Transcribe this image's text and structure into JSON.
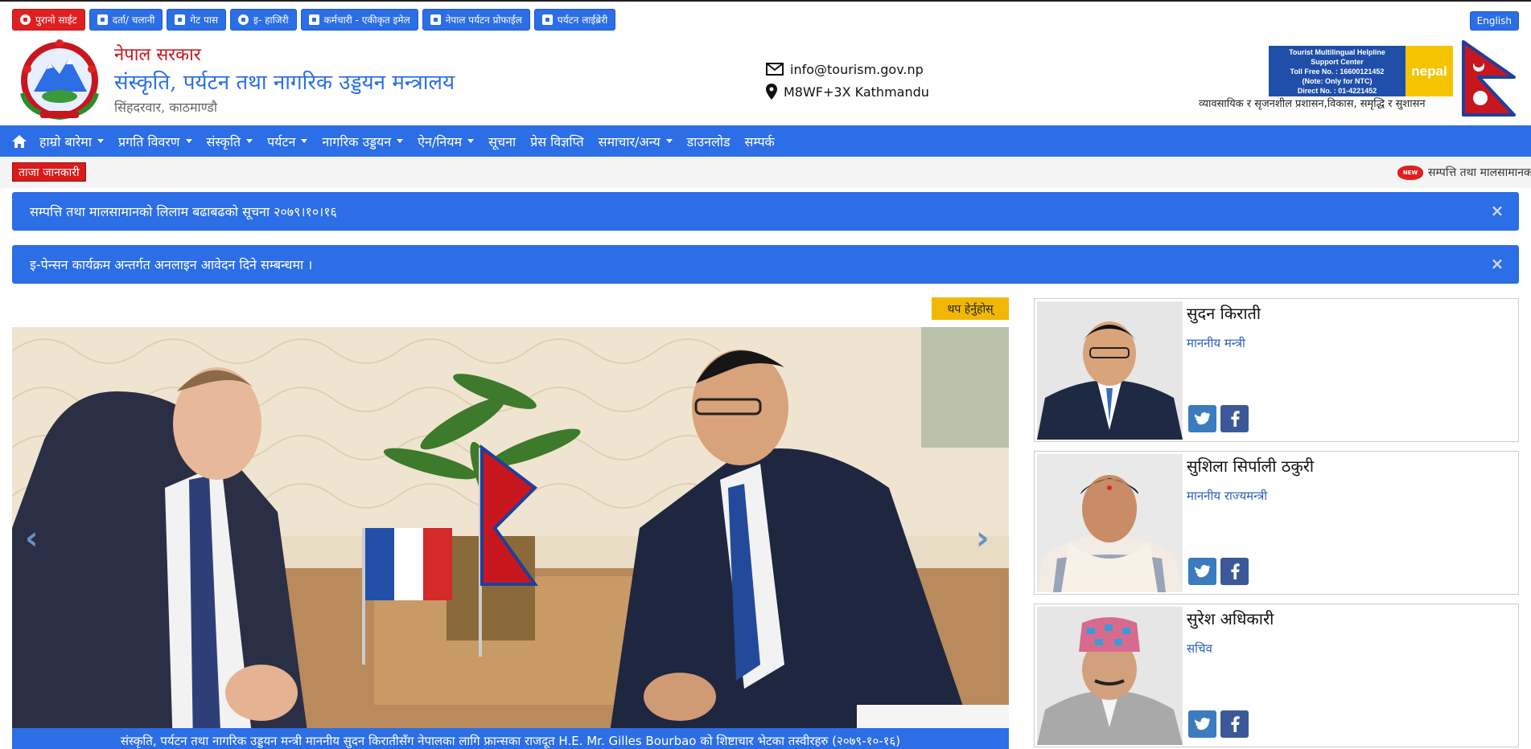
{
  "quick_links": [
    {
      "label": "पुरानो साईट",
      "icon": "globe-icon",
      "color": "#e02020"
    },
    {
      "label": "दर्ता/ चलानी",
      "icon": "calendar-icon",
      "color": "#2b6ee6"
    },
    {
      "label": "गेट पास",
      "icon": "lock-icon",
      "color": "#2b6ee6"
    },
    {
      "label": "इ- हाजिरी",
      "icon": "clock-icon",
      "color": "#2b6ee6"
    },
    {
      "label": "कर्मचारी - एकीकृत इमेल",
      "icon": "envelope-icon",
      "color": "#2b6ee6"
    },
    {
      "label": "नेपाल पर्यटन प्रोफाईल",
      "icon": "calendar-icon",
      "color": "#2b6ee6"
    },
    {
      "label": "पर्यटन लाईब्रेरी",
      "icon": "book-icon",
      "color": "#2b6ee6"
    }
  ],
  "language_button": "English",
  "header": {
    "government": "नेपाल सरकार",
    "ministry": "संस्कृति, पर्यटन तथा नागरिक उड्डयन मन्त्रालय",
    "address": "सिंहदरवार, काठमाण्डौ",
    "email": "info@tourism.gov.np",
    "location": "M8WF+3X Kathmandu",
    "helpline": {
      "line1": "Tourist Multilingual Helpline",
      "line2": "Support Center",
      "line3": "Toll Free No. : 16600121452",
      "line4": "(Note: Only for NTC)",
      "line5": "Direct No. : 01-4221452",
      "brand": "nepal"
    },
    "slogan": "व्यावसायिक र सृजनशील प्रशासन,विकास, समृद्धि र सुशासन"
  },
  "nav": {
    "items": [
      {
        "label": "हाम्रो बारेमा",
        "dropdown": true
      },
      {
        "label": "प्रगति विवरण",
        "dropdown": true
      },
      {
        "label": "संस्कृति",
        "dropdown": true
      },
      {
        "label": "पर्यटन",
        "dropdown": true
      },
      {
        "label": "नागरिक उड्डयन",
        "dropdown": true
      },
      {
        "label": "ऐन/नियम",
        "dropdown": true
      },
      {
        "label": "सूचना",
        "dropdown": false
      },
      {
        "label": "प्रेस विज्ञप्ति",
        "dropdown": false
      },
      {
        "label": "समाचार/अन्य",
        "dropdown": true
      },
      {
        "label": "डाउनलोड",
        "dropdown": false
      },
      {
        "label": "सम्पर्क",
        "dropdown": false
      }
    ]
  },
  "news": {
    "label": "ताजा जानकारी",
    "badge": "NEW",
    "ticker_text": "सम्पत्ति तथा मालसामानक"
  },
  "alerts": [
    {
      "text": "सम्पत्ति तथा मालसामानको लिलाम बढाबढको सूचना २०७९।१०।१६",
      "close": "×"
    },
    {
      "text": "इ-पेन्सन कार्यक्रम अन्तर्गत अनलाइन आवेदन दिने सम्बन्धमा ।",
      "close": "×"
    }
  ],
  "more_button": "थप हेर्नुहोस्",
  "carousel": {
    "caption": "संस्कृति, पर्यटन तथा नागरिक उड्डयन मन्त्री माननीय सुदन किरातीसँग नेपालका लागि फ्रान्सका राजदूत H.E. Mr. Gilles Bourbao को शिष्टाचार भेटका तस्वीरहरु (२०७९-१०-१६)",
    "prev": "‹",
    "next": "›"
  },
  "officials": [
    {
      "name": "सुदन किराती",
      "role": "माननीय मन्त्री"
    },
    {
      "name": "सुशिला सिर्पाली ठकुरी",
      "role": "माननीय राज्यमन्त्री"
    },
    {
      "name": "सुरेश अधिकारी",
      "role": "सचिव"
    }
  ],
  "colors": {
    "primary": "#2b6ee6",
    "danger": "#e02020",
    "accent": "#f2b705"
  }
}
